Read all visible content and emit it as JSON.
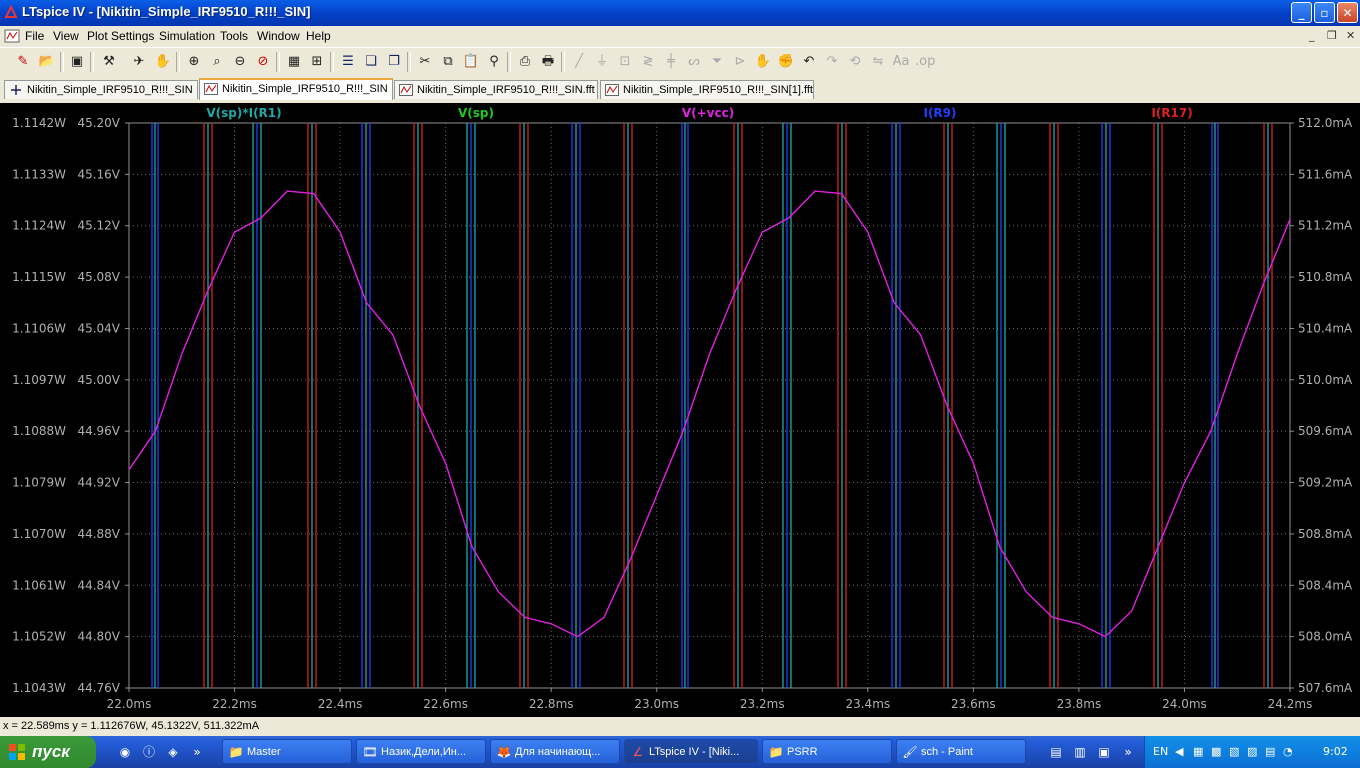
{
  "window": {
    "title": "LTspice IV - [Nikitin_Simple_IRF9510_R!!!_SIN]"
  },
  "menu": [
    "File",
    "View",
    "Plot Settings",
    "Simulation",
    "Tools",
    "Window",
    "Help"
  ],
  "tabs": [
    {
      "label": "Nikitin_Simple_IRF9510_R!!!_SIN",
      "active": false
    },
    {
      "label": "Nikitin_Simple_IRF9510_R!!!_SIN",
      "active": true
    },
    {
      "label": "Nikitin_Simple_IRF9510_R!!!_SIN.fft",
      "active": false
    },
    {
      "label": "Nikitin_Simple_IRF9510_R!!!_SIN[1].fft",
      "active": false
    }
  ],
  "toolbar_icons": [
    "new-schematic-icon",
    "open-icon",
    "save-icon",
    "control-panel-icon",
    "run-icon",
    "halt-icon",
    "zoom-in-icon",
    "zoom-area-icon",
    "zoom-out-icon",
    "zoom-cancel-icon",
    "autorange-icon",
    "pick-visible-traces-icon",
    "tile-horizontal-icon",
    "cascade-icon",
    "close-all-icon",
    "cut-icon",
    "copy-icon",
    "paste-icon",
    "find-icon",
    "print-preview-icon",
    "print-icon"
  ],
  "chart_data": {
    "type": "line",
    "x_unit": "s",
    "xlim": [
      0.022,
      0.0242
    ],
    "x_ticks": [
      "22.0ms",
      "22.2ms",
      "22.4ms",
      "22.6ms",
      "22.8ms",
      "23.0ms",
      "23.2ms",
      "23.4ms",
      "23.6ms",
      "23.8ms",
      "24.0ms",
      "24.2ms"
    ],
    "y_left1_ticks": [
      "1.1142W",
      "1.1133W",
      "1.1124W",
      "1.1115W",
      "1.1106W",
      "1.1097W",
      "1.1088W",
      "1.1079W",
      "1.1070W",
      "1.1061W",
      "1.1052W",
      "1.1043W"
    ],
    "y_left2_ticks": [
      "45.20V",
      "45.16V",
      "45.12V",
      "45.08V",
      "45.04V",
      "45.00V",
      "44.96V",
      "44.92V",
      "44.88V",
      "44.84V",
      "44.80V",
      "44.76V"
    ],
    "y_right_ticks": [
      "512.0mA",
      "511.6mA",
      "511.2mA",
      "510.8mA",
      "510.4mA",
      "510.0mA",
      "509.6mA",
      "509.2mA",
      "508.8mA",
      "508.4mA",
      "508.0mA",
      "507.6mA"
    ],
    "ylim_V": [
      44.76,
      45.2
    ],
    "series": [
      {
        "name": "V(sp)*I(R1)",
        "color": "#1fa8a8"
      },
      {
        "name": "V(sp)",
        "color": "#1fc81f"
      },
      {
        "name": "V(+vcc)",
        "color": "#e020e0",
        "x": [
          22.0,
          22.05,
          22.1,
          22.15,
          22.2,
          22.25,
          22.3,
          22.35,
          22.4,
          22.45,
          22.5,
          22.55,
          22.6,
          22.65,
          22.7,
          22.75,
          22.8,
          22.85,
          22.9,
          22.95,
          23.0,
          23.05,
          23.1,
          23.15,
          23.2,
          23.25,
          23.3,
          23.35,
          23.4,
          23.45,
          23.5,
          23.55,
          23.6,
          23.65,
          23.7,
          23.75,
          23.8,
          23.85,
          23.9,
          23.95,
          24.0,
          24.05,
          24.1,
          24.15,
          24.2
        ],
        "y": [
          44.93,
          44.96,
          45.02,
          45.07,
          45.115,
          45.126,
          45.147,
          45.145,
          45.115,
          45.06,
          45.035,
          44.98,
          44.935,
          44.87,
          44.835,
          44.815,
          44.81,
          44.8,
          44.815,
          44.86,
          44.91,
          44.96,
          45.02,
          45.07,
          45.115,
          45.126,
          45.147,
          45.145,
          45.115,
          45.06,
          45.035,
          44.98,
          44.935,
          44.87,
          44.835,
          44.815,
          44.81,
          44.8,
          44.82,
          44.87,
          44.92,
          44.96,
          45.02,
          45.075,
          45.125
        ]
      },
      {
        "name": "I(R9)",
        "color": "#2040ff"
      },
      {
        "name": "I(R17)",
        "color": "#e02020"
      }
    ]
  },
  "status": {
    "cursor": "x = 22.589ms    y = 1.112676W, 45.1322V, 511.322mA"
  },
  "taskbar": {
    "start_label": "пуск",
    "buttons": [
      {
        "label": "Master",
        "icon": "folder-icon",
        "active": false
      },
      {
        "label": "Назик,Дели,Ин...",
        "icon": "film-icon",
        "active": false
      },
      {
        "label": "Для начинающ...",
        "icon": "firefox-icon",
        "active": false
      },
      {
        "label": "LTspice IV - [Niki...",
        "icon": "ltspice-icon",
        "active": true
      },
      {
        "label": "PSRR",
        "icon": "folder-icon",
        "active": false
      },
      {
        "label": "sch - Paint",
        "icon": "paint-icon",
        "active": false
      }
    ],
    "lang": "EN",
    "clock": "9:02"
  }
}
